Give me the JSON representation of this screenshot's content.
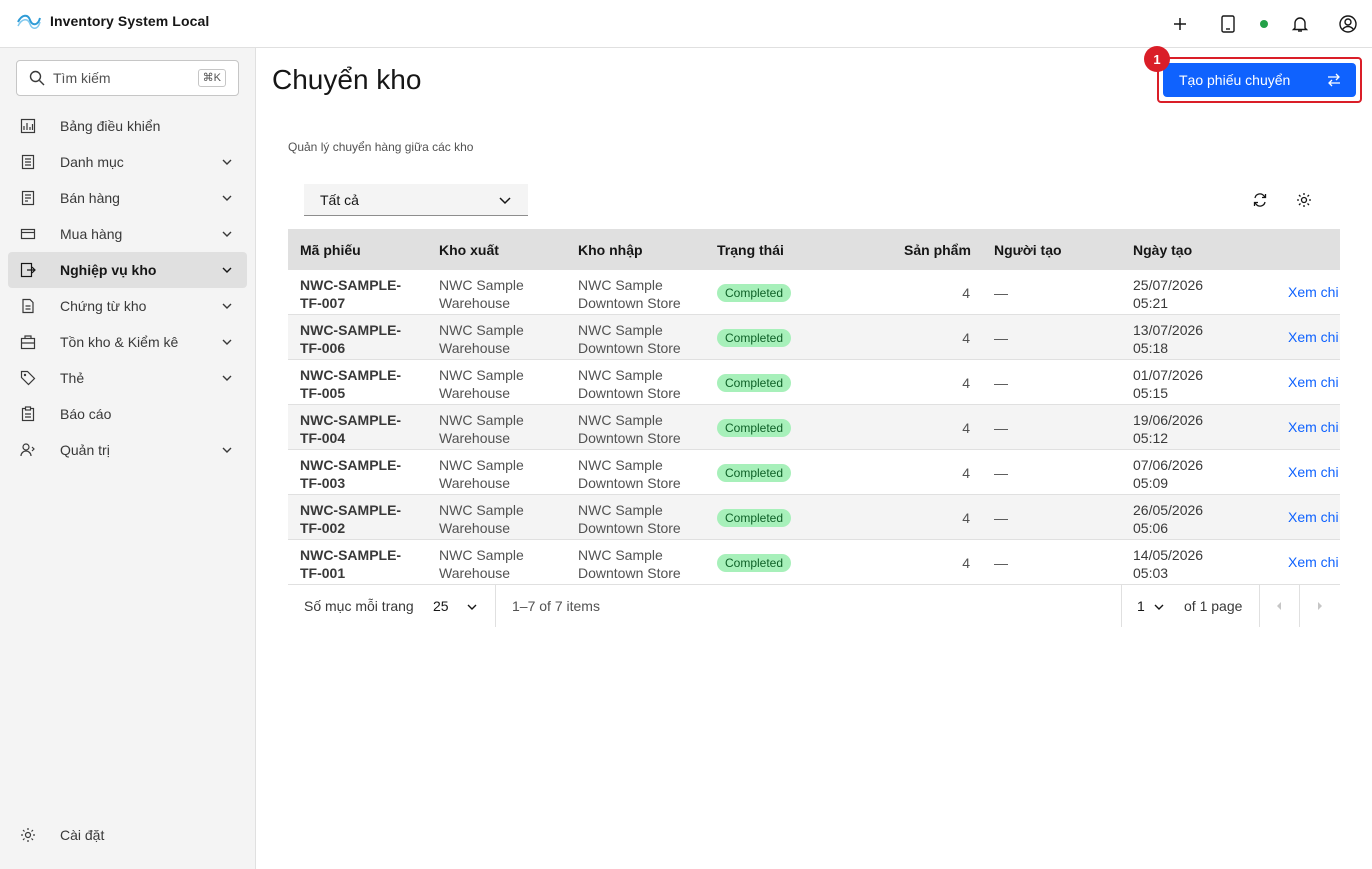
{
  "header": {
    "app_title": "Inventory System Local",
    "icons": [
      "add-icon",
      "tablet-icon",
      "status-online",
      "notification-icon",
      "user-avatar-icon"
    ]
  },
  "sidebar": {
    "search": {
      "placeholder": "Tìm kiếm",
      "shortcut": "⌘K"
    },
    "items": [
      {
        "label": "Bảng điều khiển",
        "icon": "dashboard-icon",
        "expandable": false
      },
      {
        "label": "Danh mục",
        "icon": "catalog-icon",
        "expandable": true
      },
      {
        "label": "Bán hàng",
        "icon": "sales-icon",
        "expandable": true
      },
      {
        "label": "Mua hàng",
        "icon": "purchase-icon",
        "expandable": true
      },
      {
        "label": "Nghiệp vụ kho",
        "icon": "warehouse-ops-icon",
        "expandable": true,
        "active": true
      },
      {
        "label": "Chứng từ kho",
        "icon": "document-icon",
        "expandable": true
      },
      {
        "label": "Tồn kho & Kiểm kê",
        "icon": "inventory-icon",
        "expandable": true
      },
      {
        "label": "Thẻ",
        "icon": "tag-icon",
        "expandable": true
      },
      {
        "label": "Báo cáo",
        "icon": "report-icon",
        "expandable": false
      },
      {
        "label": "Quản trị",
        "icon": "admin-icon",
        "expandable": true
      }
    ],
    "settings_label": "Cài đặt"
  },
  "main": {
    "title": "Chuyển kho",
    "subtitle": "Quản lý chuyển hàng giữa các kho",
    "create_button": "Tạo phiếu chuyển",
    "step_badge": "1",
    "filter": {
      "selected": "Tất cả"
    },
    "table": {
      "columns": [
        "Mã phiếu",
        "Kho xuất",
        "Kho nhập",
        "Trạng thái",
        "Sản phẩm",
        "Người tạo",
        "Ngày tạo"
      ],
      "rows": [
        {
          "code1": "NWC-SAMPLE-",
          "code2": "TF-007",
          "from1": "NWC Sample",
          "from2": "Warehouse",
          "to1": "NWC Sample",
          "to2": "Downtown Store",
          "status": "Completed",
          "products": "4",
          "creator": "—",
          "date": "25/07/2026",
          "time": "05:21",
          "action": "Xem chi tiết"
        },
        {
          "code1": "NWC-SAMPLE-",
          "code2": "TF-006",
          "from1": "NWC Sample",
          "from2": "Warehouse",
          "to1": "NWC Sample",
          "to2": "Downtown Store",
          "status": "Completed",
          "products": "4",
          "creator": "—",
          "date": "13/07/2026",
          "time": "05:18",
          "action": "Xem chi tiết"
        },
        {
          "code1": "NWC-SAMPLE-",
          "code2": "TF-005",
          "from1": "NWC Sample",
          "from2": "Warehouse",
          "to1": "NWC Sample",
          "to2": "Downtown Store",
          "status": "Completed",
          "products": "4",
          "creator": "—",
          "date": "01/07/2026",
          "time": "05:15",
          "action": "Xem chi tiết"
        },
        {
          "code1": "NWC-SAMPLE-",
          "code2": "TF-004",
          "from1": "NWC Sample",
          "from2": "Warehouse",
          "to1": "NWC Sample",
          "to2": "Downtown Store",
          "status": "Completed",
          "products": "4",
          "creator": "—",
          "date": "19/06/2026",
          "time": "05:12",
          "action": "Xem chi tiết"
        },
        {
          "code1": "NWC-SAMPLE-",
          "code2": "TF-003",
          "from1": "NWC Sample",
          "from2": "Warehouse",
          "to1": "NWC Sample",
          "to2": "Downtown Store",
          "status": "Completed",
          "products": "4",
          "creator": "—",
          "date": "07/06/2026",
          "time": "05:09",
          "action": "Xem chi tiết"
        },
        {
          "code1": "NWC-SAMPLE-",
          "code2": "TF-002",
          "from1": "NWC Sample",
          "from2": "Warehouse",
          "to1": "NWC Sample",
          "to2": "Downtown Store",
          "status": "Completed",
          "products": "4",
          "creator": "—",
          "date": "26/05/2026",
          "time": "05:06",
          "action": "Xem chi tiết"
        },
        {
          "code1": "NWC-SAMPLE-",
          "code2": "TF-001",
          "from1": "NWC Sample",
          "from2": "Warehouse",
          "to1": "NWC Sample",
          "to2": "Downtown Store",
          "status": "Completed",
          "products": "4",
          "creator": "—",
          "date": "14/05/2026",
          "time": "05:03",
          "action": "Xem chi tiết"
        }
      ]
    },
    "pagination": {
      "items_per_page_label": "Số mục mỗi trang",
      "page_size": "25",
      "range": "1–7 of 7 items",
      "current_page": "1",
      "of_pages": "of 1 page"
    }
  },
  "colors": {
    "primary": "#0f62fe",
    "highlight": "#da1e28",
    "success_bg": "#a7f0ba",
    "success_fg": "#0e6027"
  }
}
